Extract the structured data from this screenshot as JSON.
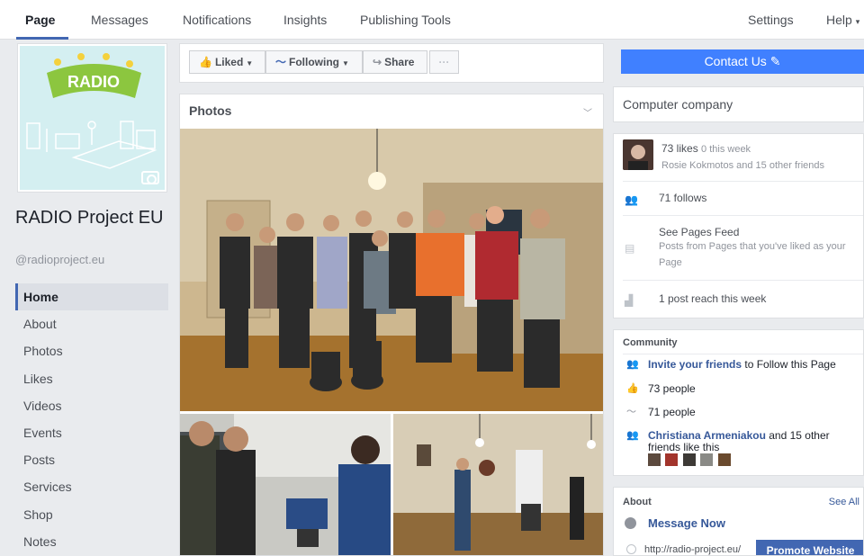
{
  "topnav": {
    "tabs": [
      {
        "label": "Page",
        "active": true
      },
      {
        "label": "Messages"
      },
      {
        "label": "Notifications"
      },
      {
        "label": "Insights"
      },
      {
        "label": "Publishing Tools"
      }
    ],
    "settings_label": "Settings",
    "help_label": "Help",
    "help_caret": "▾"
  },
  "page": {
    "name": "RADIO Project EU",
    "handle": "@radioproject.eu",
    "cover_logo_text": "RADIO"
  },
  "leftnav": {
    "items": [
      {
        "label": "Home",
        "active": true
      },
      {
        "label": "About"
      },
      {
        "label": "Photos"
      },
      {
        "label": "Likes"
      },
      {
        "label": "Videos"
      },
      {
        "label": "Events"
      },
      {
        "label": "Posts"
      },
      {
        "label": "Services"
      },
      {
        "label": "Shop"
      },
      {
        "label": "Notes"
      }
    ]
  },
  "actions": {
    "liked": {
      "label": "Liked",
      "icon": "thumbs-up-icon"
    },
    "following": {
      "label": "Following",
      "icon": "rss-icon"
    },
    "share": {
      "label": "Share",
      "icon": "share-arrow-icon"
    },
    "more": "···",
    "contact": "Contact Us ✎"
  },
  "photos": {
    "title": "Photos"
  },
  "right": {
    "category": "Computer company",
    "likes": {
      "main": "73 likes",
      "week": "0 this week",
      "friends": "Rosie Kokmotos and 15 other friends"
    },
    "follows": "71 follows",
    "pages_feed": {
      "title": "See Pages Feed",
      "desc": "Posts from Pages that you've liked as your Page"
    },
    "reach": "1 post reach this week",
    "community": {
      "title": "Community",
      "invite_link": "Invite your friends",
      "invite_rest": " to Follow this Page",
      "people_like": "73 people",
      "people_follow": "71 people",
      "friend_name": "Christiana Armeniakou",
      "friend_rest": " and 15 other friends like this"
    },
    "about": {
      "title": "About",
      "see_all": "See All",
      "message_now": "Message Now",
      "url": "http://radio-project.eu/",
      "promote": "Promote Website"
    }
  },
  "colors": {
    "accent": "#4267b2",
    "contact_button": "#4080ff",
    "link": "#365899",
    "background": "#e9ebee"
  }
}
